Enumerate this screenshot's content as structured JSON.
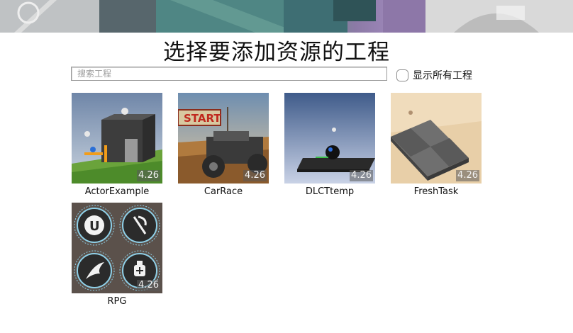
{
  "dialog": {
    "title": "选择要添加资源的工程"
  },
  "search": {
    "placeholder": "搜索工程",
    "value": ""
  },
  "show_all": {
    "label": "显示所有工程",
    "checked": false
  },
  "projects": [
    {
      "name": "ActorExample",
      "version": "4.26"
    },
    {
      "name": "CarRace",
      "version": "4.26"
    },
    {
      "name": "DLCTtemp",
      "version": "4.26"
    },
    {
      "name": "FreshTask",
      "version": "4.26"
    },
    {
      "name": "RPG",
      "version": "4.26"
    }
  ],
  "thumbnails": {
    "carrace_sign": "START"
  }
}
